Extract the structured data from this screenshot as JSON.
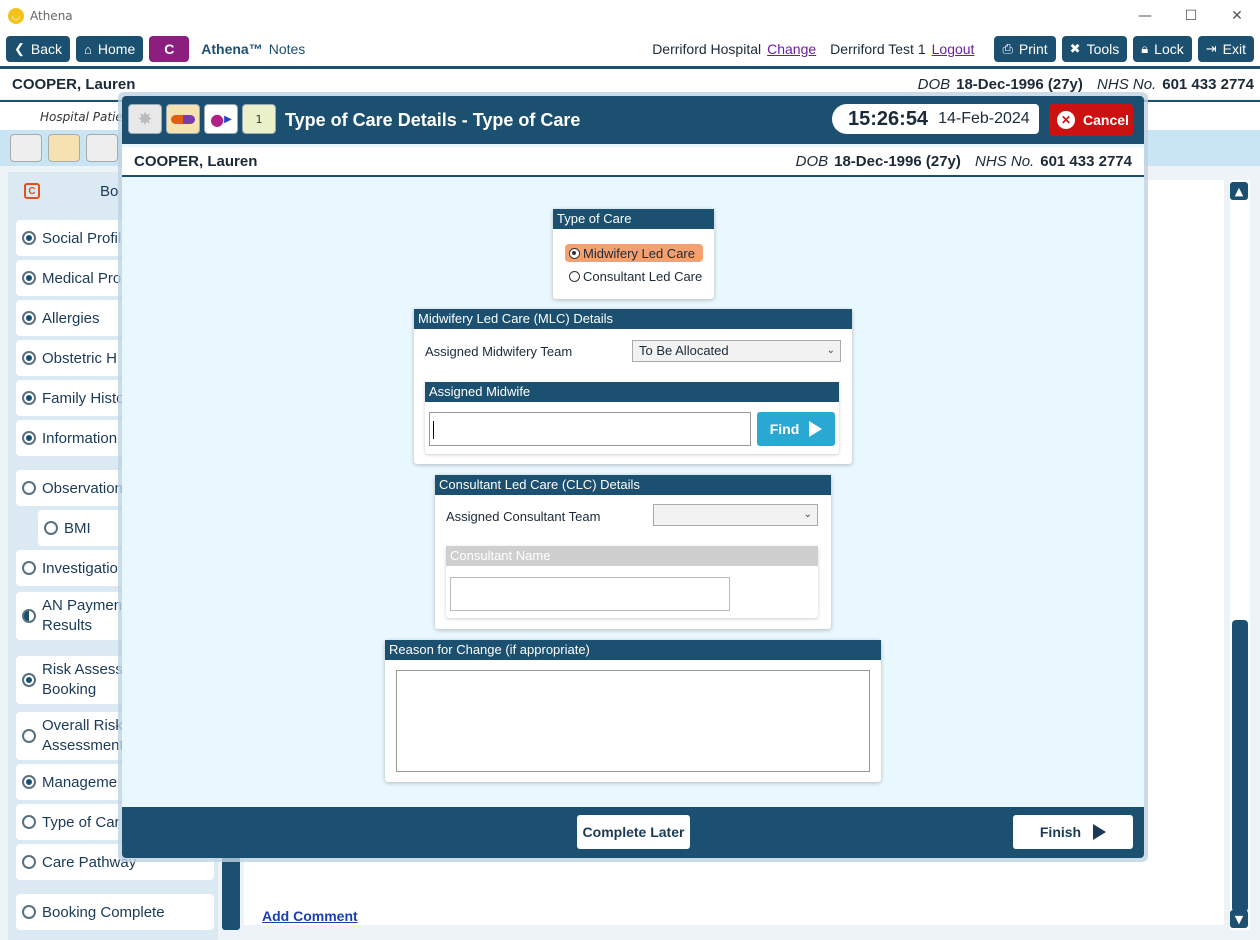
{
  "window": {
    "title": "Athena",
    "minimize": "—",
    "maximize": "☐",
    "close": "✕"
  },
  "toolbar": {
    "back": "Back",
    "home": "Home",
    "c_label": "C",
    "brand": "Athena™",
    "brand_sub": "Notes",
    "hospital": "Derriford Hospital",
    "change": "Change",
    "user": "Derriford Test 1",
    "logout": "Logout",
    "print": "Print",
    "tools": "Tools",
    "lock": "Lock",
    "exit": "Exit"
  },
  "patient": {
    "name": "COOPER, Lauren",
    "dob_label": "DOB",
    "dob": "18-Dec-1996 (27y)",
    "nhs_label": "NHS No.",
    "nhs": "601 433 2774",
    "hospital_partial": "Hospital Patie"
  },
  "sidebar": {
    "header": "Bo",
    "items": [
      {
        "label": "Social Profil",
        "state": "on"
      },
      {
        "label": "Medical Pro",
        "state": "on"
      },
      {
        "label": "Allergies",
        "state": "on"
      },
      {
        "label": "Obstetric H",
        "state": "on"
      },
      {
        "label": "Family Histo",
        "state": "on"
      },
      {
        "label": "Information",
        "state": "on"
      },
      {
        "label": "Observation",
        "state": "off"
      },
      {
        "label": "BMI",
        "state": "off"
      },
      {
        "label": "Investigatio",
        "state": "off"
      },
      {
        "label": "AN Paymen\nResults",
        "state": "half"
      },
      {
        "label": "Risk Assess\nBooking",
        "state": "on"
      },
      {
        "label": "Overall Risk\nAssessment",
        "state": "off"
      },
      {
        "label": "Manageme",
        "state": "on"
      },
      {
        "label": "Type of Car",
        "state": "off"
      },
      {
        "label": "Care Pathway",
        "state": "off"
      },
      {
        "label": "Booking Complete",
        "state": "off"
      }
    ]
  },
  "add_comment": "Add Comment",
  "modal": {
    "title": "Type of Care Details - Type of Care",
    "time": "15:26:54",
    "date": "14-Feb-2024",
    "cancel": "Cancel",
    "type_of_care": {
      "header": "Type of Care",
      "options": [
        "Midwifery Led Care",
        "Consultant Led Care"
      ],
      "selected": "Midwifery Led Care"
    },
    "mlc": {
      "header": "Midwifery Led Care (MLC) Details",
      "team_label": "Assigned Midwifery Team",
      "team_value": "To Be Allocated",
      "midwife_header": "Assigned Midwife",
      "midwife_value": "",
      "find": "Find"
    },
    "clc": {
      "header": "Consultant Led Care (CLC) Details",
      "team_label": "Assigned Consultant Team",
      "team_value": "",
      "name_header": "Consultant Name",
      "name_value": ""
    },
    "reason": {
      "header": "Reason for Change (if appropriate)",
      "value": ""
    },
    "complete_later": "Complete Later",
    "finish": "Finish"
  }
}
